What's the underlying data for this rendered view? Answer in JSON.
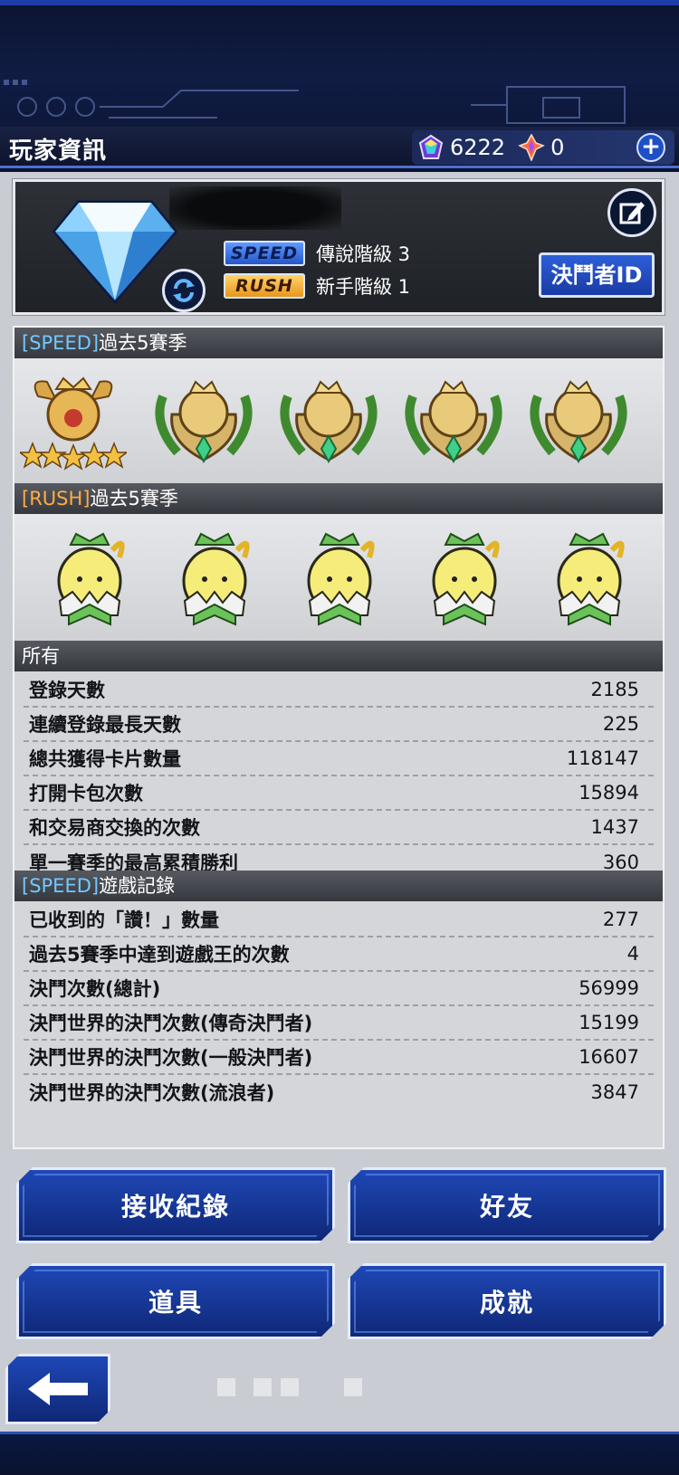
{
  "header": {
    "title": "玩家資訊",
    "gems": "6222",
    "crystals": "0",
    "plus_icon": "plus-icon"
  },
  "profile": {
    "avatar_icon": "diamond-rank-icon",
    "speed_badge": "SPEED",
    "speed_rank": "傳說階級 3",
    "rush_badge": "RUSH",
    "rush_rank": "新手階級 1",
    "duelist_id_label": "決鬥者ID"
  },
  "sections": {
    "speed_past_tag": "[SPEED]",
    "speed_past_text": "過去5賽季",
    "rush_past_tag": "[RUSH]",
    "rush_past_text": "過去5賽季",
    "all_title": "所有",
    "speed_record_tag": "[SPEED]",
    "speed_record_text": "遊戲記錄"
  },
  "speed_medals": [
    "king-of-games-medal",
    "legend-medal",
    "legend-medal",
    "legend-medal",
    "legend-medal"
  ],
  "rush_medals": [
    "rookie-egg-medal",
    "rookie-egg-medal",
    "rookie-egg-medal",
    "rookie-egg-medal",
    "rookie-egg-medal"
  ],
  "all_stats": [
    {
      "label": "登錄天數",
      "value": "2185"
    },
    {
      "label": "連續登錄最長天數",
      "value": "225"
    },
    {
      "label": "總共獲得卡片數量",
      "value": "118147"
    },
    {
      "label": "打開卡包次數",
      "value": "15894"
    },
    {
      "label": "和交易商交換的次數",
      "value": "1437"
    },
    {
      "label": "單一賽季的最高累積勝利",
      "value": "360"
    }
  ],
  "speed_stats": [
    {
      "label": "已收到的「讚！」數量",
      "value": "277"
    },
    {
      "label": "過去5賽季中達到遊戲王的次數",
      "value": "4"
    },
    {
      "label": "決鬥次數(總計)",
      "value": "56999"
    },
    {
      "label": "決鬥世界的決鬥次數(傳奇決鬥者)",
      "value": "15199"
    },
    {
      "label": "決鬥世界的決鬥次數(一般決鬥者)",
      "value": "16607"
    },
    {
      "label": "決鬥世界的決鬥次數(流浪者)",
      "value": "3847"
    }
  ],
  "buttons": {
    "receive_log": "接收紀錄",
    "friends": "好友",
    "items": "道具",
    "achievements": "成就",
    "back_icon": "back-arrow-icon"
  }
}
